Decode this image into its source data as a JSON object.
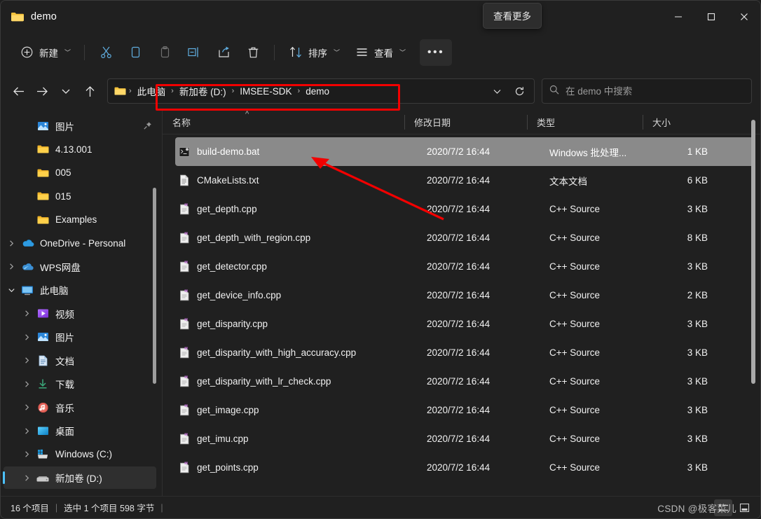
{
  "window": {
    "title": "demo",
    "folder_icon": "folder-icon",
    "tooltip": "查看更多",
    "controls": {
      "minimize": "最小化",
      "maximize": "最大化",
      "close": "关闭"
    }
  },
  "toolbar": {
    "new_label": "新建",
    "sort_label": "排序",
    "view_label": "查看",
    "more_label": "…",
    "icons": [
      "plus-icon",
      "cut-icon",
      "copy-icon",
      "paste-icon",
      "rename-icon",
      "share-icon",
      "delete-icon",
      "sort-icon",
      "view-icon",
      "more-icon"
    ]
  },
  "address": {
    "back": "后退",
    "forward": "前进",
    "recent": "最近使用的位置",
    "up": "向上",
    "crumbs": [
      "此电脑",
      "新加卷 (D:)",
      "IMSEE-SDK",
      "demo"
    ],
    "separator": "›",
    "dropdown_icon": "chevron-down-icon",
    "refresh_icon": "refresh-icon",
    "annotation_color": "#f20000"
  },
  "search": {
    "placeholder": "在 demo 中搜索",
    "value": "",
    "icon": "search-icon"
  },
  "sidebar": {
    "items": [
      {
        "label": "图片",
        "icon": "pictures-icon",
        "indent": 1,
        "twisty": "",
        "pinned": true,
        "selected": false
      },
      {
        "label": "4.13.001",
        "icon": "folder-icon",
        "indent": 1,
        "twisty": "",
        "pinned": false,
        "selected": false
      },
      {
        "label": "005",
        "icon": "folder-icon",
        "indent": 1,
        "twisty": "",
        "pinned": false,
        "selected": false
      },
      {
        "label": "015",
        "icon": "folder-icon",
        "indent": 1,
        "twisty": "",
        "pinned": false,
        "selected": false
      },
      {
        "label": "Examples",
        "icon": "folder-icon",
        "indent": 1,
        "twisty": "",
        "pinned": false,
        "selected": false
      },
      {
        "label": "OneDrive - Personal",
        "icon": "onedrive-icon",
        "indent": 0,
        "twisty": "collapsed",
        "pinned": false,
        "selected": false
      },
      {
        "label": "WPS网盘",
        "icon": "wpscloud-icon",
        "indent": 0,
        "twisty": "collapsed",
        "pinned": false,
        "selected": false
      },
      {
        "label": "此电脑",
        "icon": "thispc-icon",
        "indent": 0,
        "twisty": "expanded",
        "pinned": false,
        "selected": false
      },
      {
        "label": "视频",
        "icon": "videos-icon",
        "indent": 1,
        "twisty": "collapsed",
        "pinned": false,
        "selected": false
      },
      {
        "label": "图片",
        "icon": "pictures-icon",
        "indent": 1,
        "twisty": "collapsed",
        "pinned": false,
        "selected": false
      },
      {
        "label": "文档",
        "icon": "documents-icon",
        "indent": 1,
        "twisty": "collapsed",
        "pinned": false,
        "selected": false
      },
      {
        "label": "下载",
        "icon": "downloads-icon",
        "indent": 1,
        "twisty": "collapsed",
        "pinned": false,
        "selected": false
      },
      {
        "label": "音乐",
        "icon": "music-icon",
        "indent": 1,
        "twisty": "collapsed",
        "pinned": false,
        "selected": false
      },
      {
        "label": "桌面",
        "icon": "desktop-icon",
        "indent": 1,
        "twisty": "collapsed",
        "pinned": false,
        "selected": false
      },
      {
        "label": "Windows (C:)",
        "icon": "windows-drive-icon",
        "indent": 1,
        "twisty": "collapsed",
        "pinned": false,
        "selected": false
      },
      {
        "label": "新加卷 (D:)",
        "icon": "drive-icon",
        "indent": 1,
        "twisty": "collapsed",
        "pinned": false,
        "selected": true
      }
    ]
  },
  "filelist": {
    "columns": [
      "名称",
      "修改日期",
      "类型",
      "大小"
    ],
    "sort_column": "名称",
    "sort_direction": "ascending",
    "rows": [
      {
        "name": "build-demo.bat",
        "date": "2020/7/2 16:44",
        "type": "Windows 批处理...",
        "size": "1 KB",
        "icon": "bat-file-icon",
        "selected": true
      },
      {
        "name": "CMakeLists.txt",
        "date": "2020/7/2 16:44",
        "type": "文本文档",
        "size": "6 KB",
        "icon": "txt-file-icon",
        "selected": false
      },
      {
        "name": "get_depth.cpp",
        "date": "2020/7/2 16:44",
        "type": "C++ Source",
        "size": "3 KB",
        "icon": "cpp-file-icon",
        "selected": false
      },
      {
        "name": "get_depth_with_region.cpp",
        "date": "2020/7/2 16:44",
        "type": "C++ Source",
        "size": "8 KB",
        "icon": "cpp-file-icon",
        "selected": false
      },
      {
        "name": "get_detector.cpp",
        "date": "2020/7/2 16:44",
        "type": "C++ Source",
        "size": "3 KB",
        "icon": "cpp-file-icon",
        "selected": false
      },
      {
        "name": "get_device_info.cpp",
        "date": "2020/7/2 16:44",
        "type": "C++ Source",
        "size": "2 KB",
        "icon": "cpp-file-icon",
        "selected": false
      },
      {
        "name": "get_disparity.cpp",
        "date": "2020/7/2 16:44",
        "type": "C++ Source",
        "size": "3 KB",
        "icon": "cpp-file-icon",
        "selected": false
      },
      {
        "name": "get_disparity_with_high_accuracy.cpp",
        "date": "2020/7/2 16:44",
        "type": "C++ Source",
        "size": "3 KB",
        "icon": "cpp-file-icon",
        "selected": false
      },
      {
        "name": "get_disparity_with_lr_check.cpp",
        "date": "2020/7/2 16:44",
        "type": "C++ Source",
        "size": "3 KB",
        "icon": "cpp-file-icon",
        "selected": false
      },
      {
        "name": "get_image.cpp",
        "date": "2020/7/2 16:44",
        "type": "C++ Source",
        "size": "3 KB",
        "icon": "cpp-file-icon",
        "selected": false
      },
      {
        "name": "get_imu.cpp",
        "date": "2020/7/2 16:44",
        "type": "C++ Source",
        "size": "3 KB",
        "icon": "cpp-file-icon",
        "selected": false
      },
      {
        "name": "get_points.cpp",
        "date": "2020/7/2 16:44",
        "type": "C++ Source",
        "size": "3 KB",
        "icon": "cpp-file-icon",
        "selected": false
      }
    ]
  },
  "statusbar": {
    "item_count": "16 个项目",
    "selection": "选中 1 个项目  598 字节",
    "separator": "|",
    "view_details_icon": "details-view-icon",
    "view_large_icon": "large-icons-view-icon"
  },
  "watermark": {
    "text": "CSDN @极客菜儿"
  },
  "colors": {
    "accent": "#4cc2ff",
    "annotation": "#f20000",
    "selection": "#8a8a8a",
    "window_bg": "#202020"
  }
}
